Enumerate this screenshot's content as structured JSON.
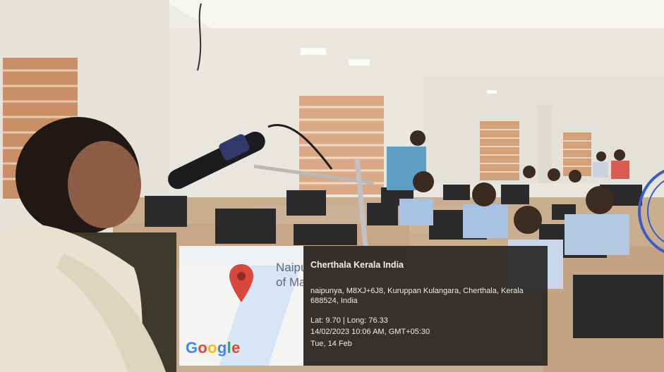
{
  "photo": {
    "description_tag": "classroom-lecture-photo"
  },
  "map_overlay": {
    "place_label_line1": "Naipun",
    "place_label_line2": "of Man",
    "google_logo_letters": [
      "G",
      "o",
      "o",
      "g",
      "l",
      "e"
    ],
    "google_logo_colors": [
      "#4285F4",
      "#EA4335",
      "#FBBC05",
      "#4285F4",
      "#34A853",
      "#EA4335"
    ],
    "pin_color": "#d9473d"
  },
  "geo_info": {
    "title": "Cherthala Kerala India",
    "address": "naipunya, M8XJ+6J8, Kuruppan Kulangara, Cherthala, Kerala 688524, India",
    "latlong": "Lat: 9.70 | Long: 76.33",
    "datetime": "14/02/2023 10:06 AM, GMT+05:30",
    "day": "Tue, 14 Feb"
  },
  "colors": {
    "info_panel_bg": "#282624",
    "info_text": "#f0ece4",
    "seal_blue": "#3a5fc4"
  }
}
